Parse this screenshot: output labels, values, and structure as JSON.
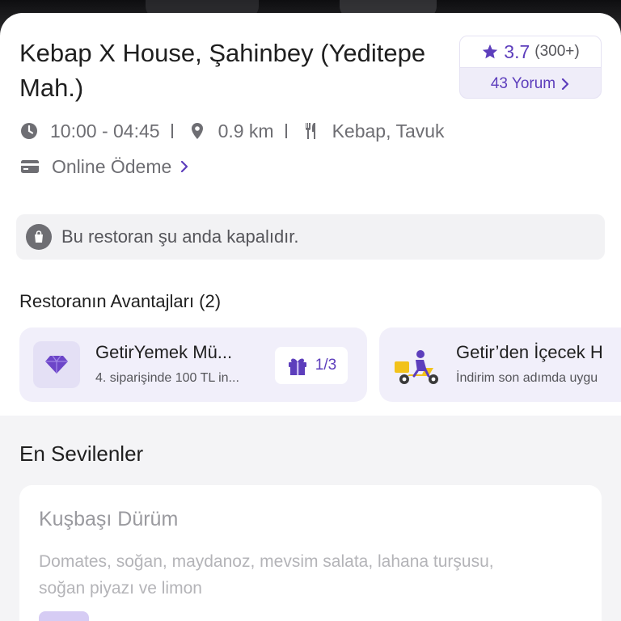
{
  "restaurant": {
    "name": "Kebap X House, Şahinbey (Yeditepe Mah.)",
    "rating": "3.7",
    "rating_count": "(300+)",
    "reviews_link": "43 Yorum",
    "hours": "10:00 - 04:45",
    "distance": "0.9 km",
    "cuisine": "Kebap, Tavuk",
    "payment": "Online Ödeme"
  },
  "status_banner": {
    "text": "Bu restoran şu anda kapalıdır."
  },
  "advantages": {
    "heading": "Restoranın Avantajları (2)",
    "items": [
      {
        "title": "GetirYemek Mü...",
        "subtitle": "4. siparişinde 100 TL in...",
        "progress": "1/3",
        "icon": "diamond-icon"
      },
      {
        "title": "Getir’den İçecek H",
        "subtitle": "İndirim son adımda uygu",
        "icon": "courier-scooter-icon"
      }
    ]
  },
  "favorites": {
    "heading": "En Sevilenler",
    "items": [
      {
        "name": "Kuşbaşı Dürüm",
        "description": "Domates, soğan, maydanoz, mevsim salata, lahana turşusu, soğan piyazı ve limon"
      }
    ]
  },
  "colors": {
    "accent": "#5d3ebc",
    "accent_light": "#f1effa",
    "muted_text": "#6e6e73"
  }
}
